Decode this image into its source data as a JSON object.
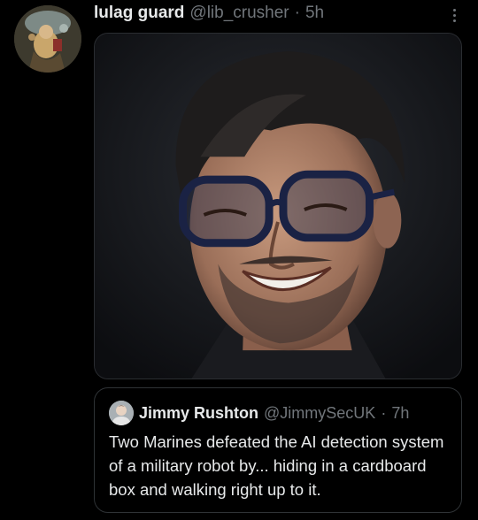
{
  "tweet": {
    "author": {
      "display_name": "lulag guard",
      "handle": "@lib_crusher",
      "separator": "·",
      "time": "5h",
      "avatar_icon": "profile-avatar-painting"
    },
    "more_icon": "more-options-icon",
    "media": {
      "type": "photo"
    },
    "quoted_tweet": {
      "author": {
        "display_name": "Jimmy Rushton",
        "handle": "@JimmySecUK",
        "separator": "·",
        "time": "7h",
        "avatar_icon": "profile-avatar-photo"
      },
      "text": "Two Marines defeated the AI detection system of a military robot by... hiding in a cardboard box and walking right up to it."
    }
  },
  "colors": {
    "background": "#000000",
    "primary_text": "#e7e9ea",
    "secondary_text": "#71767b",
    "border": "#2f3336"
  }
}
